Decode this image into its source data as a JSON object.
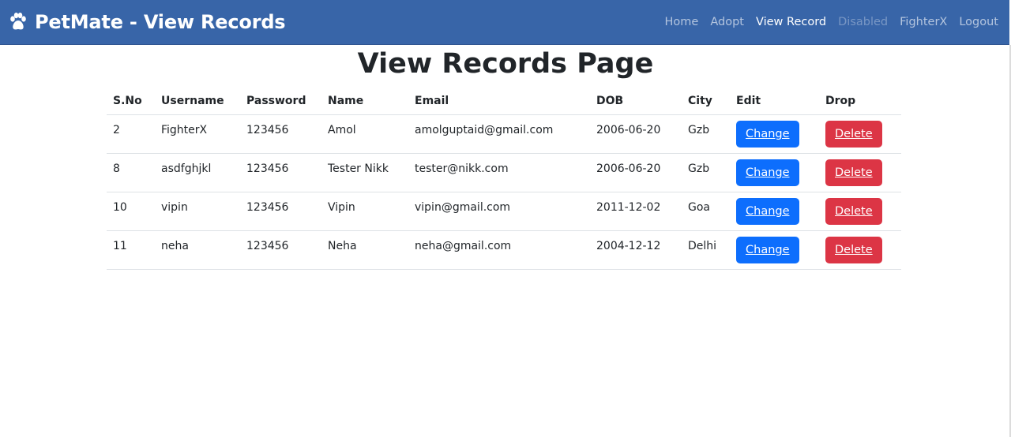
{
  "navbar": {
    "brand": "PetMate - View Records",
    "links": [
      {
        "label": "Home",
        "state": "normal"
      },
      {
        "label": "Adopt",
        "state": "normal"
      },
      {
        "label": "View Record",
        "state": "active"
      },
      {
        "label": "Disabled",
        "state": "disabled"
      },
      {
        "label": "FighterX",
        "state": "normal"
      },
      {
        "label": "Logout",
        "state": "normal"
      }
    ]
  },
  "page_title": "View Records Page",
  "table": {
    "headers": [
      "S.No",
      "Username",
      "Password",
      "Name",
      "Email",
      "DOB",
      "City",
      "Edit",
      "Drop"
    ],
    "rows": [
      {
        "sno": "2",
        "username": "FighterX",
        "password": "123456",
        "name": "Amol",
        "email": "amolguptaid@gmail.com",
        "dob": "2006-06-20",
        "city": "Gzb",
        "edit": "Change",
        "drop": "Delete"
      },
      {
        "sno": "8",
        "username": "asdfghjkl",
        "password": "123456",
        "name": "Tester Nikk",
        "email": "tester@nikk.com",
        "dob": "2006-06-20",
        "city": "Gzb",
        "edit": "Change",
        "drop": "Delete"
      },
      {
        "sno": "10",
        "username": "vipin",
        "password": "123456",
        "name": "Vipin",
        "email": "vipin@gmail.com",
        "dob": "2011-12-02",
        "city": "Goa",
        "edit": "Change",
        "drop": "Delete"
      },
      {
        "sno": "11",
        "username": "neha",
        "password": "123456",
        "name": "Neha",
        "email": "neha@gmail.com",
        "dob": "2004-12-12",
        "city": "Delhi",
        "edit": "Change",
        "drop": "Delete"
      }
    ]
  },
  "colors": {
    "navbar": "#3865a8",
    "primary": "#0d6efd",
    "danger": "#dc3545"
  },
  "icons": {
    "brand": "paw-icon"
  }
}
